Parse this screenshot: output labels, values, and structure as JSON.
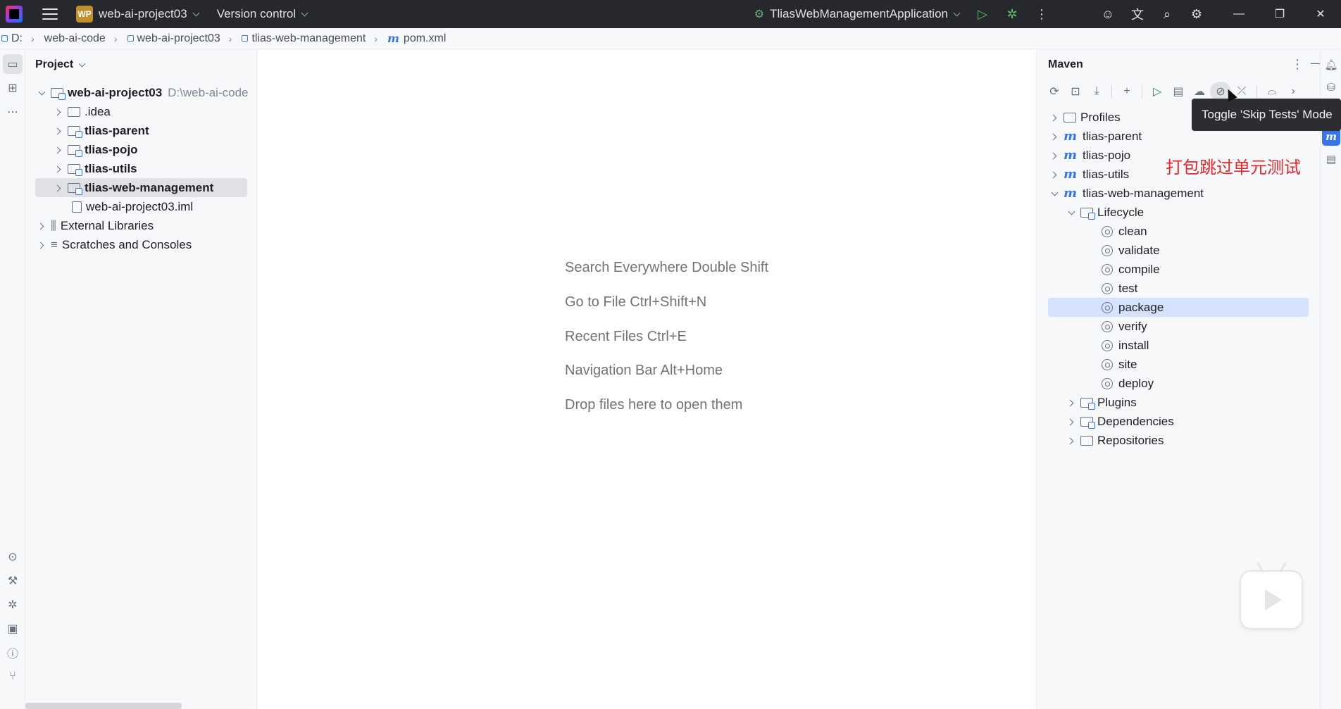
{
  "titlebar": {
    "project_badge": "WP",
    "project_name": "web-ai-project03",
    "vcs_label": "Version control",
    "run_config": "TliasWebManagementApplication"
  },
  "breadcrumb": [
    "D:",
    "web-ai-code",
    "web-ai-project03",
    "tlias-web-management",
    "pom.xml"
  ],
  "project_panel": {
    "title": "Project",
    "tree": [
      {
        "label": "web-ai-project03",
        "path": "D:\\web-ai-code",
        "bold": true
      },
      {
        "label": ".idea"
      },
      {
        "label": "tlias-parent",
        "bold": true
      },
      {
        "label": "tlias-pojo",
        "bold": true
      },
      {
        "label": "tlias-utils",
        "bold": true
      },
      {
        "label": "tlias-web-management",
        "bold": true
      },
      {
        "label": "web-ai-project03.iml"
      },
      {
        "label": "External Libraries"
      },
      {
        "label": "Scratches and Consoles"
      }
    ]
  },
  "editor_hints": [
    {
      "text": "Search Everywhere",
      "key": "Double Shift"
    },
    {
      "text": "Go to File",
      "key": "Ctrl+Shift+N"
    },
    {
      "text": "Recent Files",
      "key": "Ctrl+E"
    },
    {
      "text": "Navigation Bar",
      "key": "Alt+Home"
    },
    {
      "text": "Drop files here to open them",
      "key": ""
    }
  ],
  "maven": {
    "title": "Maven",
    "tooltip": "Toggle 'Skip Tests' Mode",
    "annotation": "打包跳过单元测试",
    "tree": [
      {
        "label": "Profiles"
      },
      {
        "label": "tlias-parent"
      },
      {
        "label": "tlias-pojo"
      },
      {
        "label": "tlias-utils"
      },
      {
        "label": "tlias-web-management"
      },
      {
        "label": "Lifecycle"
      },
      {
        "label": "clean"
      },
      {
        "label": "validate"
      },
      {
        "label": "compile"
      },
      {
        "label": "test"
      },
      {
        "label": "package",
        "selected": true
      },
      {
        "label": "verify"
      },
      {
        "label": "install"
      },
      {
        "label": "site"
      },
      {
        "label": "deploy"
      },
      {
        "label": "Plugins"
      },
      {
        "label": "Dependencies"
      },
      {
        "label": "Repositories"
      }
    ]
  },
  "colors": {
    "accent": "#3574f0",
    "titlebar": "#27282e",
    "selection": "#d4e2ff",
    "annotation": "#e5262a"
  }
}
